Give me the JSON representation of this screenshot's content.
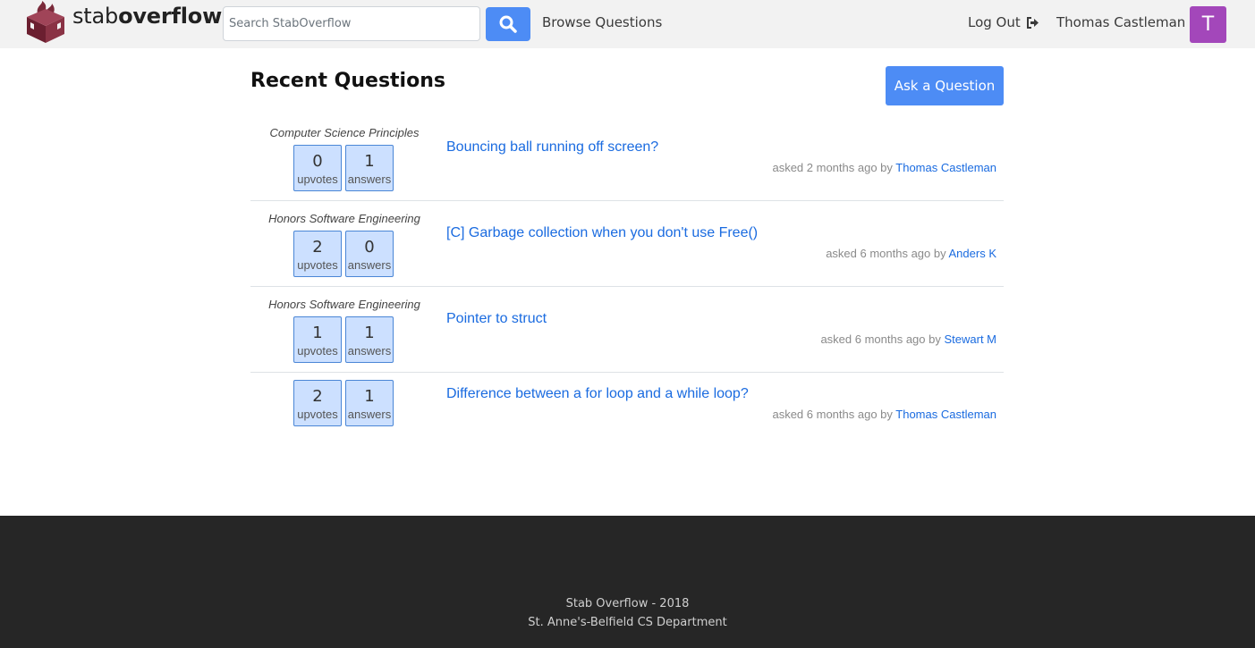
{
  "brand": {
    "name_light": "stab",
    "name_bold": "overflow",
    "icon": "logo-box-icon"
  },
  "search": {
    "placeholder": "Search StabOverflow",
    "value": "",
    "button_icon": "search-icon"
  },
  "nav": {
    "browse": "Browse Questions",
    "logout": "Log Out",
    "logout_icon": "sign-out-icon",
    "username": "Thomas Castleman",
    "avatar_letter": "T"
  },
  "main": {
    "title": "Recent Questions",
    "ask_button": "Ask a Question",
    "questions": [
      {
        "course": "Computer Science Principles",
        "upvotes": "0",
        "upvotes_label": "upvotes",
        "answers": "1",
        "answers_label": "answers",
        "title": "Bouncing ball running off screen?",
        "asked": "asked 2 months ago by",
        "author": "Thomas Castleman"
      },
      {
        "course": "Honors Software Engineering",
        "upvotes": "2",
        "upvotes_label": "upvotes",
        "answers": "0",
        "answers_label": "answers",
        "title": "[C] Garbage collection when you don't use Free()",
        "asked": "asked 6 months ago by",
        "author": "Anders K"
      },
      {
        "course": "Honors Software Engineering",
        "upvotes": "1",
        "upvotes_label": "upvotes",
        "answers": "1",
        "answers_label": "answers",
        "title": "Pointer to struct",
        "asked": "asked 6 months ago by",
        "author": "Stewart M"
      },
      {
        "course": "",
        "upvotes": "2",
        "upvotes_label": "upvotes",
        "answers": "1",
        "answers_label": "answers",
        "title": "Difference between a for loop and a while loop?",
        "asked": "asked 6 months ago by",
        "author": "Thomas Castleman"
      }
    ]
  },
  "footer": {
    "line1": "Stab Overflow - 2018",
    "line2": "St. Anne's-Belfield CS Department"
  },
  "colors": {
    "accent": "#4d8cf5",
    "link": "#1a6be0",
    "avatar": "#a347ba",
    "stat_bg": "#cce0ff",
    "footer_bg": "#262626"
  }
}
